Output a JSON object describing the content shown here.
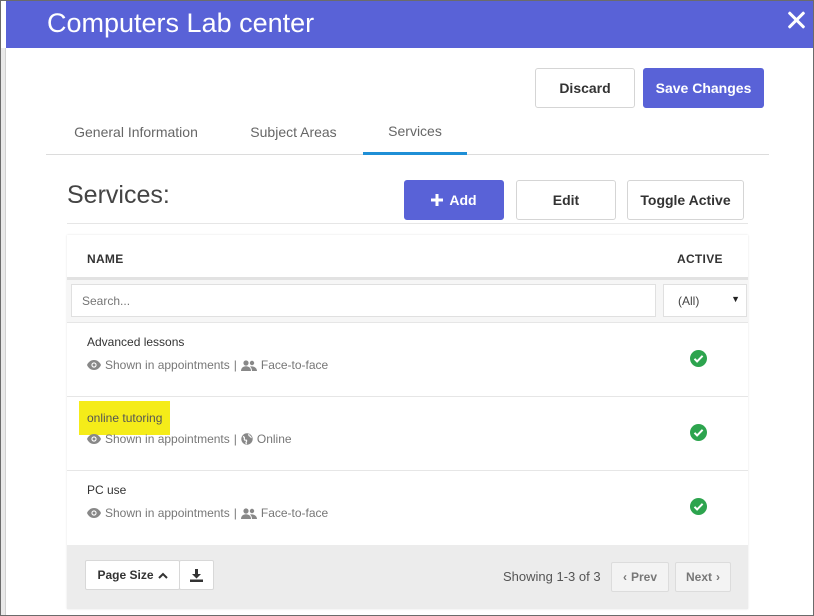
{
  "modal": {
    "title": "Computers Lab center"
  },
  "actions": {
    "discard_label": "Discard",
    "save_label": "Save Changes"
  },
  "tabs": [
    {
      "label": "General Information",
      "active": false
    },
    {
      "label": "Subject Areas",
      "active": false
    },
    {
      "label": "Services",
      "active": true
    }
  ],
  "services": {
    "title": "Services:",
    "add_label": "Add",
    "edit_label": "Edit",
    "toggle_label": "Toggle Active"
  },
  "table": {
    "columns": [
      "NAME",
      "ACTIVE"
    ],
    "search_placeholder": "Search...",
    "filter_value": "(All)",
    "rows": [
      {
        "name": "Advanced lessons",
        "shown": "Shown in appointments",
        "separator": "|",
        "mode": "Face-to-face",
        "mode_icon": "users-icon",
        "active": true
      },
      {
        "name": "online tutoring",
        "shown": "Shown in appointments",
        "separator": "|",
        "mode": "Online",
        "mode_icon": "globe-icon",
        "active": true,
        "highlighted": true
      },
      {
        "name": "PC use",
        "shown": "Shown in appointments",
        "separator": "|",
        "mode": "Face-to-face",
        "mode_icon": "users-icon",
        "active": true
      }
    ]
  },
  "pagination": {
    "page_size_label": "Page Size",
    "showing_text": "Showing 1-3 of 3",
    "prev_label": "Prev",
    "next_label": "Next"
  },
  "colors": {
    "accent": "#5962d7",
    "tab_active": "#1f8fd6",
    "active_check": "#2da44e",
    "highlight": "#f5ec19"
  }
}
